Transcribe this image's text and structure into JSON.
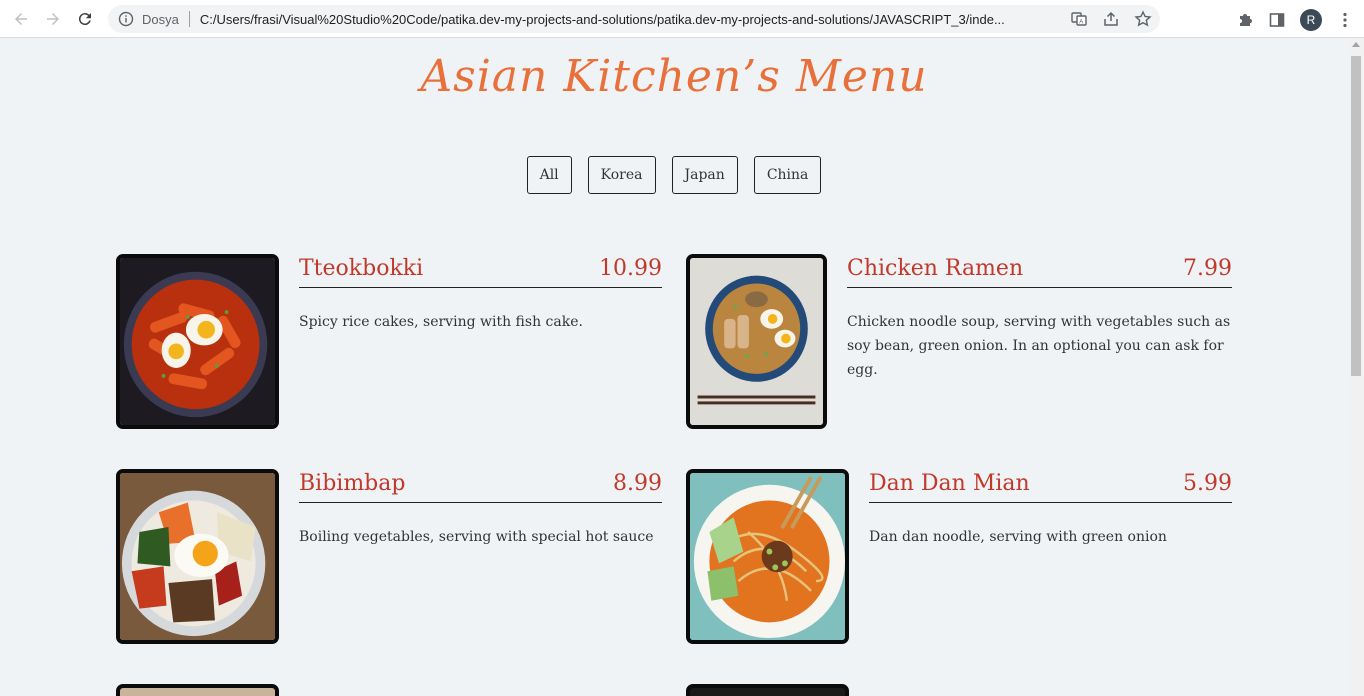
{
  "browser": {
    "site_label": "Dosya",
    "url": "C:/Users/frasi/Visual%20Studio%20Code/patika.dev-my-projects-and-solutions/patika.dev-my-projects-and-solutions/JAVASCRIPT_3/inde...",
    "avatar_letter": "R"
  },
  "page": {
    "title": "Asian Kitchen’s Menu",
    "filters": [
      "All",
      "Korea",
      "Japan",
      "China"
    ]
  },
  "menu": [
    {
      "name": "Tteokbokki",
      "price": "10.99",
      "desc": "Spicy rice cakes, serving with fish cake."
    },
    {
      "name": "Chicken Ramen",
      "price": "7.99",
      "desc": "Chicken noodle soup, serving with vegetables such as soy bean, green onion. In an optional you can ask for egg."
    },
    {
      "name": "Bibimbap",
      "price": "8.99",
      "desc": "Boiling vegetables, serving with special hot sauce"
    },
    {
      "name": "Dan Dan Mian",
      "price": "5.99",
      "desc": "Dan dan noodle, serving with green onion"
    }
  ]
}
